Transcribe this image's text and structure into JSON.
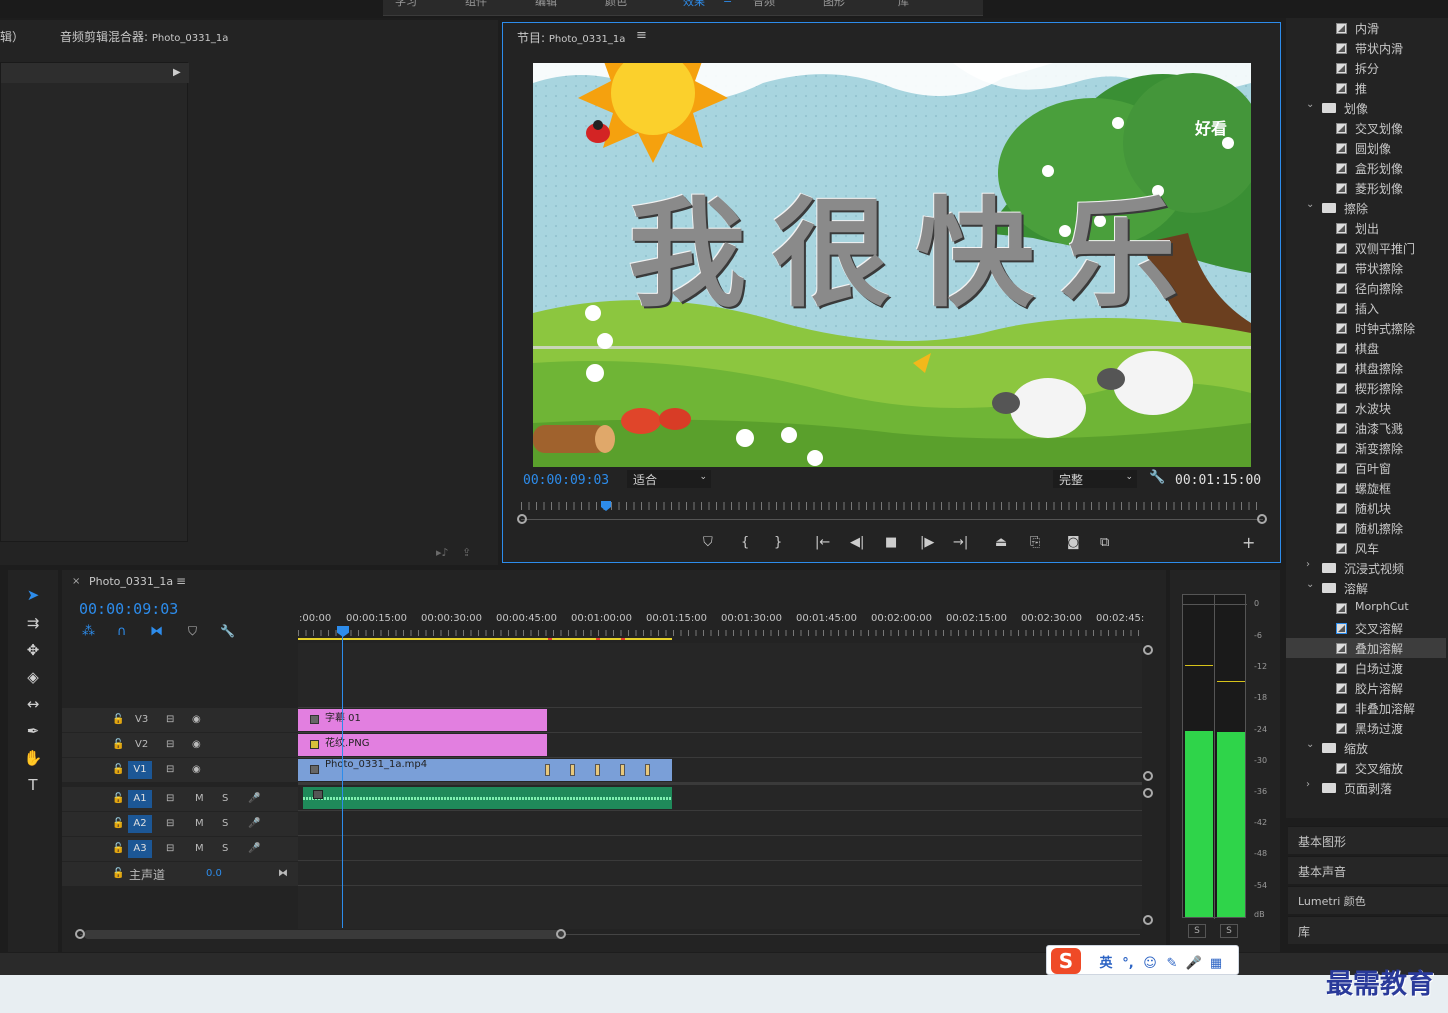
{
  "top_nav": {
    "items": [
      "学习",
      "组件",
      "编辑",
      "颜色",
      "效果",
      "音频",
      "图形",
      "库"
    ]
  },
  "left_panel": {
    "title_partial": "辑）",
    "audio_mixer_label": "音频剪辑混合器",
    "audio_mixer_clip": "Photo_0331_1a"
  },
  "program_monitor": {
    "title_prefix": "节目",
    "title_seq": "Photo_0331_1a",
    "menu_icon": "hamburger-icon",
    "frame_text": "我很快乐",
    "watermark_corner": "好看",
    "current_time": "00:00:09:03",
    "zoom_select": "适合",
    "quality_select": "完整",
    "duration": "00:01:15:00",
    "controls": [
      "marker-icon",
      "mark-in-icon",
      "mark-out-icon",
      "go-to-in-icon",
      "step-back-icon",
      "stop-icon",
      "step-forward-icon",
      "go-to-out-icon",
      "lift-icon",
      "extract-icon",
      "camera-icon",
      "compare-icon",
      "add-icon"
    ]
  },
  "timeline": {
    "tab_close": "×",
    "sequence_name": "Photo_0331_1a",
    "current_time": "00:00:09:03",
    "ruler": [
      ":00:00",
      "00:00:15:00",
      "00:00:30:00",
      "00:00:45:00",
      "00:01:00:00",
      "00:01:15:00",
      "00:01:30:00",
      "00:01:45:00",
      "00:02:00:00",
      "00:02:15:00",
      "00:02:30:00",
      "00:02:45:"
    ],
    "video_tracks": [
      {
        "name": "V3",
        "clip": "字幕 01"
      },
      {
        "name": "V2",
        "clip": "花纹.PNG"
      },
      {
        "name": "V1",
        "clip": "Photo_0331_1a.mp4"
      }
    ],
    "audio_tracks": [
      {
        "source": "A1",
        "name": "A1",
        "m": "M",
        "s": "S"
      },
      {
        "name": "A2",
        "m": "M",
        "s": "S"
      },
      {
        "name": "A3",
        "m": "M",
        "s": "S"
      }
    ],
    "master": {
      "label": "主声道",
      "value": "0.0"
    }
  },
  "meter": {
    "scale": [
      "0",
      "-6",
      "-12",
      "-18",
      "-24",
      "-30",
      "-36",
      "-42",
      "-48",
      "-54",
      "dB"
    ],
    "solo": [
      "S",
      "S"
    ],
    "left_level_db": -24,
    "right_level_db": -24,
    "colors": {
      "meter": "#2fd44a",
      "peak": "#d6c21a"
    }
  },
  "effects": {
    "items": [
      {
        "type": "effect",
        "label": "内滑"
      },
      {
        "type": "effect",
        "label": "带状内滑"
      },
      {
        "type": "effect",
        "label": "拆分"
      },
      {
        "type": "effect",
        "label": "推"
      },
      {
        "type": "folder",
        "label": "划像",
        "open": true
      },
      {
        "type": "effect",
        "label": "交叉划像"
      },
      {
        "type": "effect",
        "label": "圆划像"
      },
      {
        "type": "effect",
        "label": "盒形划像"
      },
      {
        "type": "effect",
        "label": "菱形划像"
      },
      {
        "type": "folder",
        "label": "擦除",
        "open": true
      },
      {
        "type": "effect",
        "label": "划出"
      },
      {
        "type": "effect",
        "label": "双侧平推门"
      },
      {
        "type": "effect",
        "label": "带状擦除"
      },
      {
        "type": "effect",
        "label": "径向擦除"
      },
      {
        "type": "effect",
        "label": "插入"
      },
      {
        "type": "effect",
        "label": "时钟式擦除"
      },
      {
        "type": "effect",
        "label": "棋盘"
      },
      {
        "type": "effect",
        "label": "棋盘擦除"
      },
      {
        "type": "effect",
        "label": "楔形擦除"
      },
      {
        "type": "effect",
        "label": "水波块"
      },
      {
        "type": "effect",
        "label": "油漆飞溅"
      },
      {
        "type": "effect",
        "label": "渐变擦除"
      },
      {
        "type": "effect",
        "label": "百叶窗"
      },
      {
        "type": "effect",
        "label": "螺旋框"
      },
      {
        "type": "effect",
        "label": "随机块"
      },
      {
        "type": "effect",
        "label": "随机擦除"
      },
      {
        "type": "effect",
        "label": "风车"
      },
      {
        "type": "folder",
        "label": "沉浸式视频",
        "open": false
      },
      {
        "type": "folder",
        "label": "溶解",
        "open": true
      },
      {
        "type": "effect",
        "label": "MorphCut"
      },
      {
        "type": "effect",
        "label": "交叉溶解"
      },
      {
        "type": "effect",
        "label": "叠加溶解",
        "selected": true
      },
      {
        "type": "effect",
        "label": "白场过渡"
      },
      {
        "type": "effect",
        "label": "胶片溶解"
      },
      {
        "type": "effect",
        "label": "非叠加溶解"
      },
      {
        "type": "effect",
        "label": "黑场过渡"
      },
      {
        "type": "folder",
        "label": "缩放",
        "open": true
      },
      {
        "type": "effect",
        "label": "交叉缩放"
      },
      {
        "type": "folder",
        "label": "页面剥落",
        "open": false
      }
    ],
    "sections": [
      "基本图形",
      "基本声音",
      "Lumetri 颜色",
      "库"
    ]
  },
  "ime_toolbar": {
    "logo": "S",
    "items": [
      "英",
      "°,",
      "☺",
      "✎",
      "🎤",
      "▦"
    ]
  },
  "brand_watermark": "最需教育"
}
